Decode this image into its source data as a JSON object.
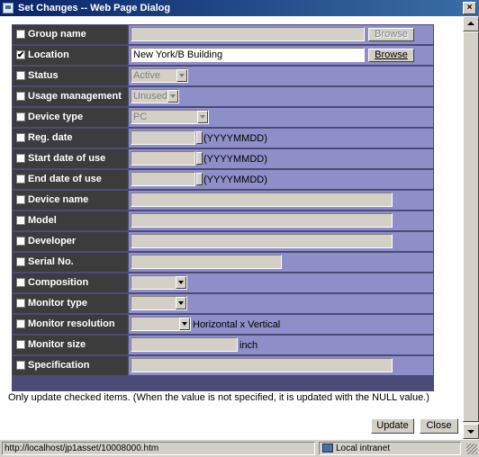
{
  "window": {
    "title": "Set Changes -- Web Page Dialog",
    "close_glyph": "×"
  },
  "check_mark": "✔",
  "fields": [
    {
      "key": "group_name",
      "label": "Group name",
      "checked": false,
      "value": "",
      "button": "Browse",
      "button_enabled": false
    },
    {
      "key": "location",
      "label": "Location",
      "checked": true,
      "value": "New York/B Building",
      "button": "Browse",
      "button_enabled": true
    },
    {
      "key": "status",
      "label": "Status",
      "checked": false,
      "value": "Active"
    },
    {
      "key": "usage_management",
      "label": "Usage management",
      "checked": false,
      "value": "Unused"
    },
    {
      "key": "device_type",
      "label": "Device type",
      "checked": false,
      "value": "PC"
    },
    {
      "key": "reg_date",
      "label": "Reg. date",
      "checked": false,
      "value": "",
      "hint": "(YYYYMMDD)"
    },
    {
      "key": "start_date",
      "label": "Start date of use",
      "checked": false,
      "value": "",
      "hint": "(YYYYMMDD)"
    },
    {
      "key": "end_date",
      "label": "End date of use",
      "checked": false,
      "value": "",
      "hint": "(YYYYMMDD)"
    },
    {
      "key": "device_name",
      "label": "Device name",
      "checked": false,
      "value": ""
    },
    {
      "key": "model",
      "label": "Model",
      "checked": false,
      "value": ""
    },
    {
      "key": "developer",
      "label": "Developer",
      "checked": false,
      "value": ""
    },
    {
      "key": "serial_no",
      "label": "Serial No.",
      "checked": false,
      "value": ""
    },
    {
      "key": "composition",
      "label": "Composition",
      "checked": false,
      "value": ""
    },
    {
      "key": "monitor_type",
      "label": "Monitor type",
      "checked": false,
      "value": ""
    },
    {
      "key": "monitor_resolution",
      "label": "Monitor resolution",
      "checked": false,
      "value": "",
      "hint": "Horizontal x Vertical"
    },
    {
      "key": "monitor_size",
      "label": "Monitor size",
      "checked": false,
      "value": "",
      "hint": "inch"
    },
    {
      "key": "specification",
      "label": "Specification",
      "checked": false,
      "value": ""
    }
  ],
  "note": "Only update checked items. (When the value is not specified, it is updated with the NULL value.)",
  "buttons": {
    "update": "Update",
    "close": "Close"
  },
  "statusbar": {
    "url": "http://localhost/jp1asset/10008000.htm",
    "zone": "Local intranet"
  },
  "icons": {
    "app": "dialog-icon",
    "zone": "intranet-zone-icon"
  }
}
